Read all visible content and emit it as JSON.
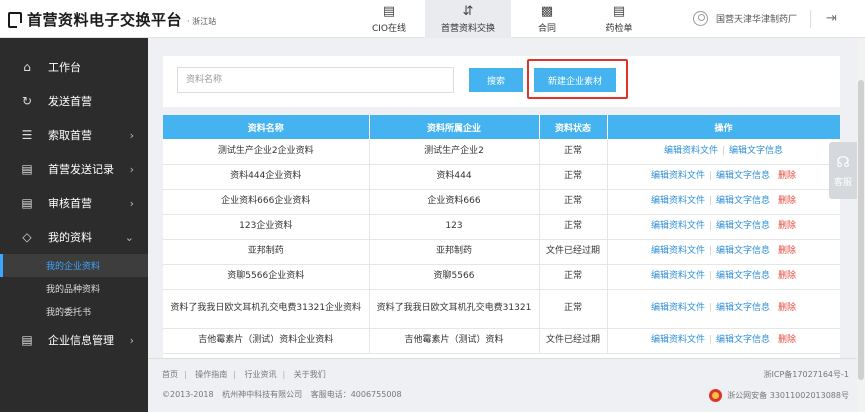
{
  "header": {
    "logo_title": "首营资料电子交换平台",
    "logo_sub": "· 浙江站",
    "nav": [
      {
        "label": "CIO在线",
        "icon": "document-icon"
      },
      {
        "label": "首营资料交换",
        "icon": "exchange-arrows-icon"
      },
      {
        "label": "合同",
        "icon": "contract-icon"
      },
      {
        "label": "药检单",
        "icon": "report-icon"
      }
    ],
    "user_name": "国营天津华津制药厂"
  },
  "sidebar": {
    "items": [
      {
        "label": "工作台",
        "icon": "home-icon"
      },
      {
        "label": "发送首营",
        "icon": "send-icon"
      },
      {
        "label": "索取首营",
        "icon": "request-icon"
      },
      {
        "label": "首营发送记录",
        "icon": "record-icon"
      },
      {
        "label": "审核首营",
        "icon": "audit-icon"
      },
      {
        "label": "我的资料",
        "icon": "layers-icon"
      },
      {
        "label": "企业信息管理",
        "icon": "company-icon"
      }
    ],
    "sub_items": [
      "我的企业资料",
      "我的品种资料",
      "我的委托书"
    ]
  },
  "search": {
    "placeholder": "资料名称",
    "button": "搜索",
    "new_button": "新建企业素材"
  },
  "table": {
    "headers": [
      "资料名称",
      "资料所属企业",
      "资料状态",
      "操作"
    ],
    "rows": [
      {
        "name": "测试生产企业2企业资料",
        "company": "测试生产企业2",
        "status": "正常",
        "ops": [
          "编辑资料文件",
          "编辑文字信息"
        ]
      },
      {
        "name": "资料444企业资料",
        "company": "资料444",
        "status": "正常",
        "ops": [
          "编辑资料文件",
          "编辑文字信息",
          "删除"
        ]
      },
      {
        "name": "企业资料666企业资料",
        "company": "企业资料666",
        "status": "正常",
        "ops": [
          "编辑资料文件",
          "编辑文字信息",
          "删除"
        ]
      },
      {
        "name": "123企业资料",
        "company": "123",
        "status": "正常",
        "ops": [
          "编辑资料文件",
          "编辑文字信息",
          "删除"
        ]
      },
      {
        "name": "亚邦制药",
        "company": "亚邦制药",
        "status": "文件已经过期",
        "ops": [
          "编辑资料文件",
          "编辑文字信息",
          "删除"
        ]
      },
      {
        "name": "资聊5566企业资料",
        "company": "资聊5566",
        "status": "正常",
        "ops": [
          "编辑资料文件",
          "编辑文字信息",
          "删除"
        ]
      },
      {
        "name": "资料了我我日欧文耳机孔交电费31321企业资料",
        "company": "资料了我我日欧文耳机孔交电费31321",
        "status": "正常",
        "ops": [
          "编辑资料文件",
          "编辑文字信息",
          "删除"
        ]
      },
      {
        "name": "吉他霉素片（测试）资料企业资料",
        "company": "吉他霉素片（测试）资料",
        "status": "文件已经过期",
        "ops": [
          "编辑资料文件",
          "编辑文字信息",
          "删除"
        ]
      }
    ]
  },
  "service": {
    "label": "客服"
  },
  "footer": {
    "links": [
      "首页",
      "操作指南",
      "行业资讯",
      "关于我们"
    ],
    "copyright": "©2013-2018",
    "company": "杭州神中科技有限公司",
    "phone": "客服电话：4006755008",
    "icp": "浙ICP备17027164号-1",
    "police": "浙公网安备 33011002013088号"
  },
  "colors": {
    "accent": "#45b3ef",
    "delete": "#e84b3c",
    "link": "#2e8fd8",
    "sidebar": "#2c2c2c",
    "highlight_box": "#e0332b"
  }
}
